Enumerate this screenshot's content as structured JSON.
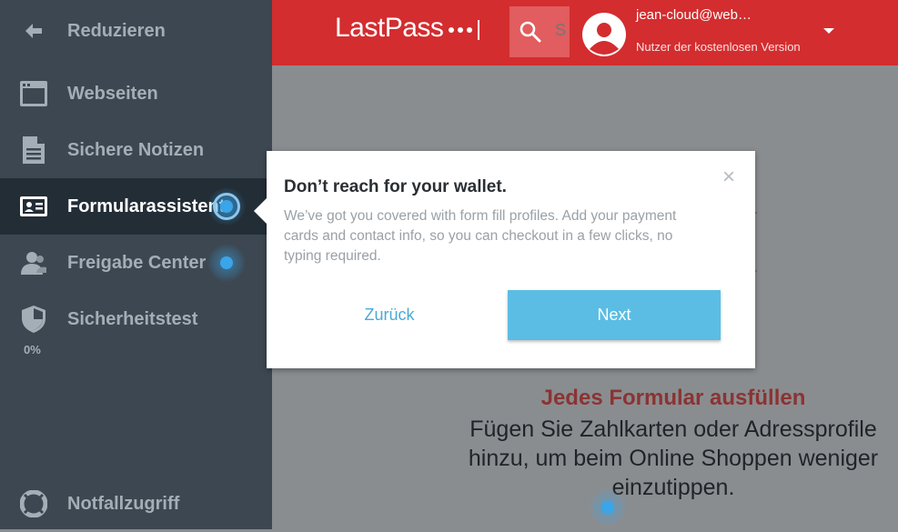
{
  "sidebar": {
    "items": [
      {
        "label": "Reduzieren",
        "icon": "arrow-left-icon"
      },
      {
        "label": "Webseiten",
        "icon": "browser-window-icon"
      },
      {
        "label": "Sichere Notizen",
        "icon": "note-icon"
      },
      {
        "label": "Formularassistent",
        "icon": "id-card-icon",
        "active": true
      },
      {
        "label": "Freigabe Center",
        "icon": "users-icon"
      },
      {
        "label": "Sicherheitstest",
        "icon": "shield-icon",
        "score": "0%"
      },
      {
        "label": "Notfallzugriff",
        "icon": "lifebuoy-icon"
      }
    ]
  },
  "header": {
    "logo_text": "LastPass",
    "search_placeholder": "S",
    "user_email": "jean-cloud@web…",
    "user_plan": "Nutzer der kostenlosen Version"
  },
  "tooltip": {
    "title": "Don’t reach for your wallet.",
    "body": "We’ve got you covered with form fill profiles. Add your payment cards and contact info, so you can checkout in a few clicks, no typing required.",
    "close": "×",
    "back_label": "Zurück",
    "next_label": "Next"
  },
  "main": {
    "title": "Jedes Formular ausfüllen",
    "description": "Fügen Sie Zahlkarten oder Adressprofile hinzu, um beim Online Shoppen weniger einzutippen."
  },
  "colors": {
    "header_red": "#d32d2f",
    "sidebar_bg": "#3c4751",
    "sidebar_active": "#232d36",
    "accent_blue": "#5bbde3",
    "title_red": "#8b3333"
  }
}
